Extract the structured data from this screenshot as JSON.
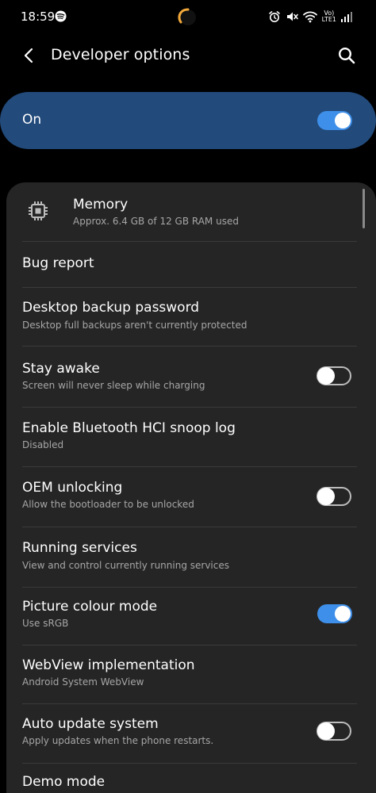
{
  "status_bar": {
    "time": "18:59",
    "volte_line1": "Vo)",
    "volte_line2": "LTE1"
  },
  "header": {
    "title": "Developer options"
  },
  "master": {
    "label": "On",
    "enabled": true
  },
  "items": [
    {
      "title": "Memory",
      "subtitle": "Approx. 6.4 GB of 12 GB RAM used"
    },
    {
      "title": "Bug report",
      "subtitle": ""
    },
    {
      "title": "Desktop backup password",
      "subtitle": "Desktop full backups aren't currently protected"
    },
    {
      "title": "Stay awake",
      "subtitle": "Screen will never sleep while charging",
      "toggle": false
    },
    {
      "title": "Enable Bluetooth HCI snoop log",
      "subtitle": "Disabled"
    },
    {
      "title": "OEM unlocking",
      "subtitle": "Allow the bootloader to be unlocked",
      "toggle": false
    },
    {
      "title": "Running services",
      "subtitle": "View and control currently running services"
    },
    {
      "title": "Picture colour mode",
      "subtitle": "Use sRGB",
      "toggle": true
    },
    {
      "title": "WebView implementation",
      "subtitle": "Android System WebView"
    },
    {
      "title": "Auto update system",
      "subtitle": "Apply updates when the phone restarts.",
      "toggle": false
    },
    {
      "title": "Demo mode",
      "subtitle": ""
    }
  ],
  "icons": {
    "back": "back-arrow-icon",
    "search": "search-icon",
    "memory": "memory-chip-icon"
  },
  "colors": {
    "background": "#000000",
    "panel": "#252525",
    "master_card": "#224a7b",
    "accent": "#3e8fe9",
    "subtitle": "#a6a6a6"
  }
}
